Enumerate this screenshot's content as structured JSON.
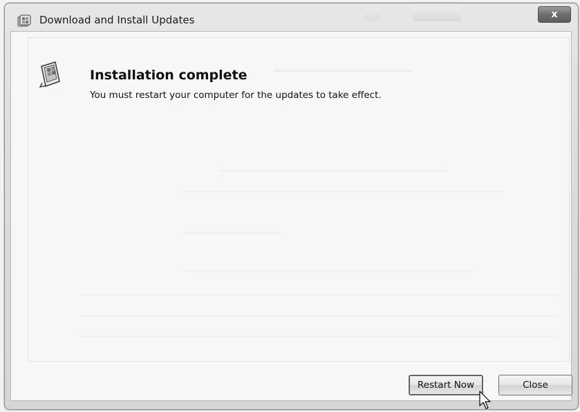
{
  "window": {
    "title": "Download and Install Updates",
    "close_glyph": "x",
    "title_icon": "windows-update-icon"
  },
  "status": {
    "icon": "windows-update-icon",
    "heading": "Installation complete",
    "message": "You must restart your computer for the updates to take effect."
  },
  "buttons": {
    "restart_label": "Restart Now",
    "close_label": "Close"
  },
  "colors": {
    "window_bg": "#dcdcdc",
    "content_bg": "#f7f7f7",
    "close_button": "#6f6f6f"
  }
}
